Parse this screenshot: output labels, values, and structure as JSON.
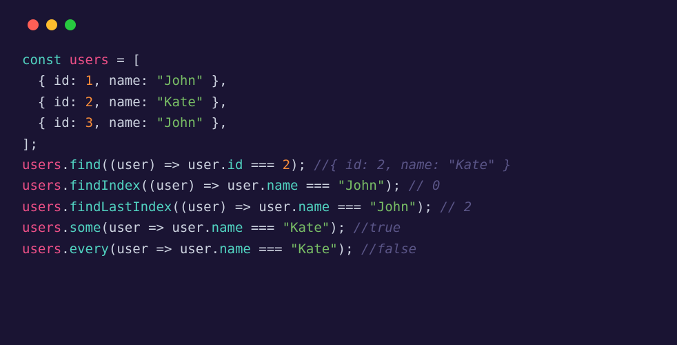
{
  "code": {
    "declaration": {
      "keyword": "const",
      "identifier": "users",
      "equals": " = ",
      "open_bracket": "["
    },
    "entries": [
      {
        "id_key": "id",
        "id_val": "1",
        "name_key": "name",
        "name_val": "\"John\""
      },
      {
        "id_key": "id",
        "id_val": "2",
        "name_key": "name",
        "name_val": "\"Kate\""
      },
      {
        "id_key": "id",
        "id_val": "3",
        "name_key": "name",
        "name_val": "\"John\""
      }
    ],
    "close_bracket": "];",
    "calls": [
      {
        "obj": "users",
        "dot": ".",
        "method": "find",
        "open": "((",
        "param": "user",
        "close_param": ") ",
        "arrow": "=>",
        "body_pre": " user",
        "body_dot": ".",
        "body_prop": "id",
        "body_op": " === ",
        "body_val": "2",
        "body_val_type": "num",
        "close": "); ",
        "comment": "//{ id: 2, name: \"Kate\" }"
      },
      {
        "obj": "users",
        "dot": ".",
        "method": "findIndex",
        "open": "((",
        "param": "user",
        "close_param": ") ",
        "arrow": "=>",
        "body_pre": " user",
        "body_dot": ".",
        "body_prop": "name",
        "body_op": " === ",
        "body_val": "\"John\"",
        "body_val_type": "str",
        "close": "); ",
        "comment": "// 0"
      },
      {
        "obj": "users",
        "dot": ".",
        "method": "findLastIndex",
        "open": "((",
        "param": "user",
        "close_param": ") ",
        "arrow": "=>",
        "body_pre": " user",
        "body_dot": ".",
        "body_prop": "name",
        "body_op": " === ",
        "body_val": "\"John\"",
        "body_val_type": "str",
        "close": "); ",
        "comment": "// 2"
      },
      {
        "obj": "users",
        "dot": ".",
        "method": "some",
        "open": "(",
        "param": "user",
        "close_param": " ",
        "arrow": "=>",
        "body_pre": " user",
        "body_dot": ".",
        "body_prop": "name",
        "body_op": " === ",
        "body_val": "\"Kate\"",
        "body_val_type": "str",
        "close": "); ",
        "comment": "//true"
      },
      {
        "obj": "users",
        "dot": ".",
        "method": "every",
        "open": "(",
        "param": "user",
        "close_param": " ",
        "arrow": "=>",
        "body_pre": " user",
        "body_dot": ".",
        "body_prop": "name",
        "body_op": " === ",
        "body_val": "\"Kate\"",
        "body_val_type": "str",
        "close": "); ",
        "comment": "//false"
      }
    ]
  }
}
